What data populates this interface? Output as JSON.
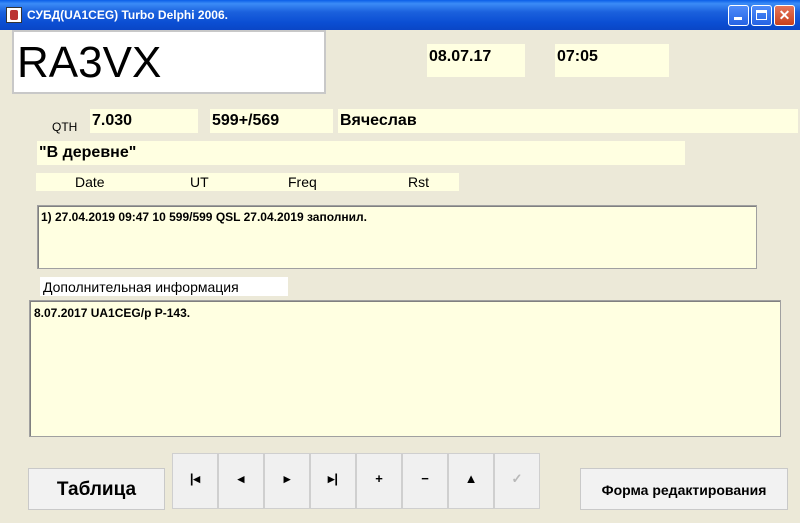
{
  "window": {
    "title": "СУБД(UA1CEG) Turbo Delphi 2006."
  },
  "record": {
    "callsign": "RA3VX",
    "date": "08.07.17",
    "time": "07:05",
    "qth_label": "QTH",
    "freq": "7.030",
    "rst": "599+/569",
    "name": "Вячеслав",
    "qth": "\"В деревне\""
  },
  "log_header": [
    "Date",
    "UT",
    "Freq",
    "Rst"
  ],
  "log_entries": [
    "1) 27.04.2019 09:47  10 599/599   QSL 27.04.2019   заполнил."
  ],
  "extra": {
    "label": "Дополнительная информация",
    "text": "8.07.2017  UA1CEG/p  P-143."
  },
  "buttons": {
    "table": "Таблица",
    "edit_form": "Форма редактирования"
  },
  "navigator": {
    "first": "|◂",
    "prior": "◂",
    "next": "▸",
    "last": "▸|",
    "insert": "+",
    "delete": "−",
    "edit": "▲",
    "post": "✓"
  }
}
